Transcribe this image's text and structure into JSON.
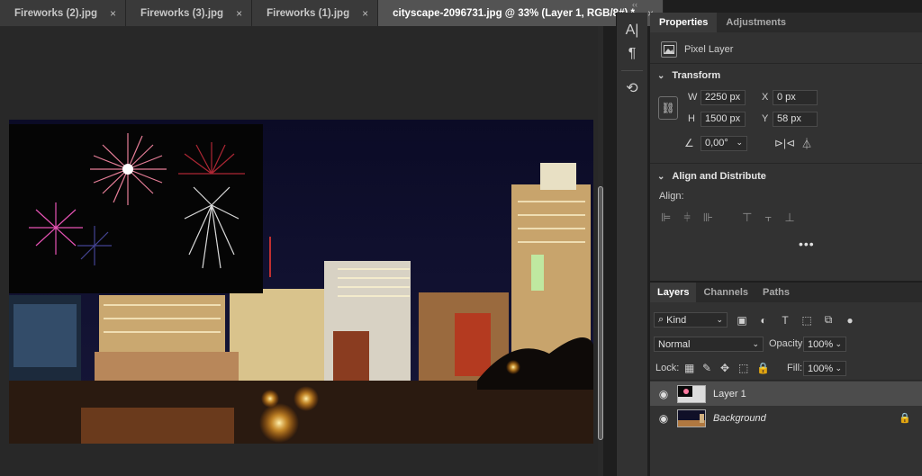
{
  "tabs": [
    {
      "label": "Fireworks (2).jpg",
      "close": "×"
    },
    {
      "label": "Fireworks (3).jpg",
      "close": "×"
    },
    {
      "label": "Fireworks (1).jpg",
      "close": "×"
    },
    {
      "label": "cityscape-2096731.jpg @ 33% (Layer 1, RGB/8#) *",
      "close": "×"
    }
  ],
  "toolstrip": {
    "collapse": "‹‹",
    "tools": [
      {
        "icon": "character-panel-icon",
        "glyph": "A|"
      },
      {
        "icon": "paragraph-panel-icon",
        "glyph": "¶"
      },
      {
        "icon": "history-panel-icon",
        "glyph": "⟲"
      }
    ]
  },
  "properties": {
    "tabs": [
      "Properties",
      "Adjustments"
    ],
    "kind_label": "Pixel Layer",
    "transform": {
      "title": "Transform",
      "w_label": "W",
      "w_value": "2250 px",
      "h_label": "H",
      "h_value": "1500 px",
      "x_label": "X",
      "x_value": "0 px",
      "y_label": "Y",
      "y_value": "58 px",
      "angle_value": "0,00°"
    },
    "align": {
      "title": "Align and Distribute",
      "label": "Align:",
      "more": "•••"
    }
  },
  "layers": {
    "tabs": [
      "Layers",
      "Channels",
      "Paths"
    ],
    "filter_kind": "Kind",
    "blend_mode": "Normal",
    "opacity_label": "Opacity:",
    "opacity_value": "100%",
    "lock_label": "Lock:",
    "fill_label": "Fill:",
    "fill_value": "100%",
    "items": [
      {
        "name": "Layer 1",
        "selected": true
      },
      {
        "name": "Background",
        "selected": false,
        "locked": true
      }
    ]
  },
  "colors": {
    "accent_selected_tab": "#535353",
    "panel_bg": "#323232",
    "night_sky": "#0c0c24"
  }
}
